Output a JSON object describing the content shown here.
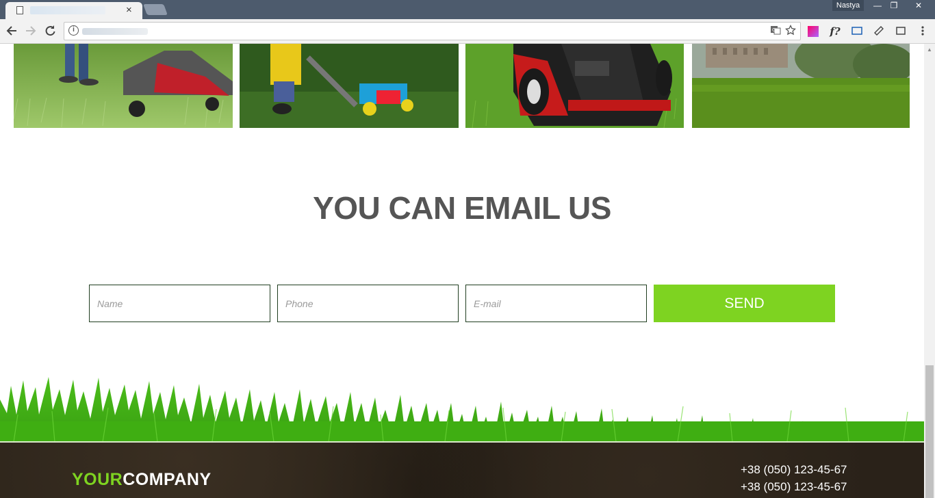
{
  "browser": {
    "user": "Nastya",
    "tab_close": "×",
    "window_controls": [
      "—",
      "❐",
      "✕"
    ]
  },
  "page": {
    "heading": "YOU CAN EMAIL US",
    "form": {
      "name_placeholder": "Name",
      "phone_placeholder": "Phone",
      "email_placeholder": "E-mail",
      "send_label": "SEND"
    },
    "footer": {
      "logo_accent": "YOUR",
      "logo_main": "COMPANY",
      "phones": [
        "+38 (050) 123-45-67",
        "+38 (050) 123-45-67"
      ]
    }
  },
  "colors": {
    "accent": "#7ed321",
    "heading": "#555555",
    "footer_bg": "#2a2219"
  },
  "icons": [
    "back-icon",
    "forward-icon",
    "reload-icon",
    "info-icon",
    "translate-icon",
    "star-icon",
    "extension-icon",
    "menu-icon"
  ]
}
